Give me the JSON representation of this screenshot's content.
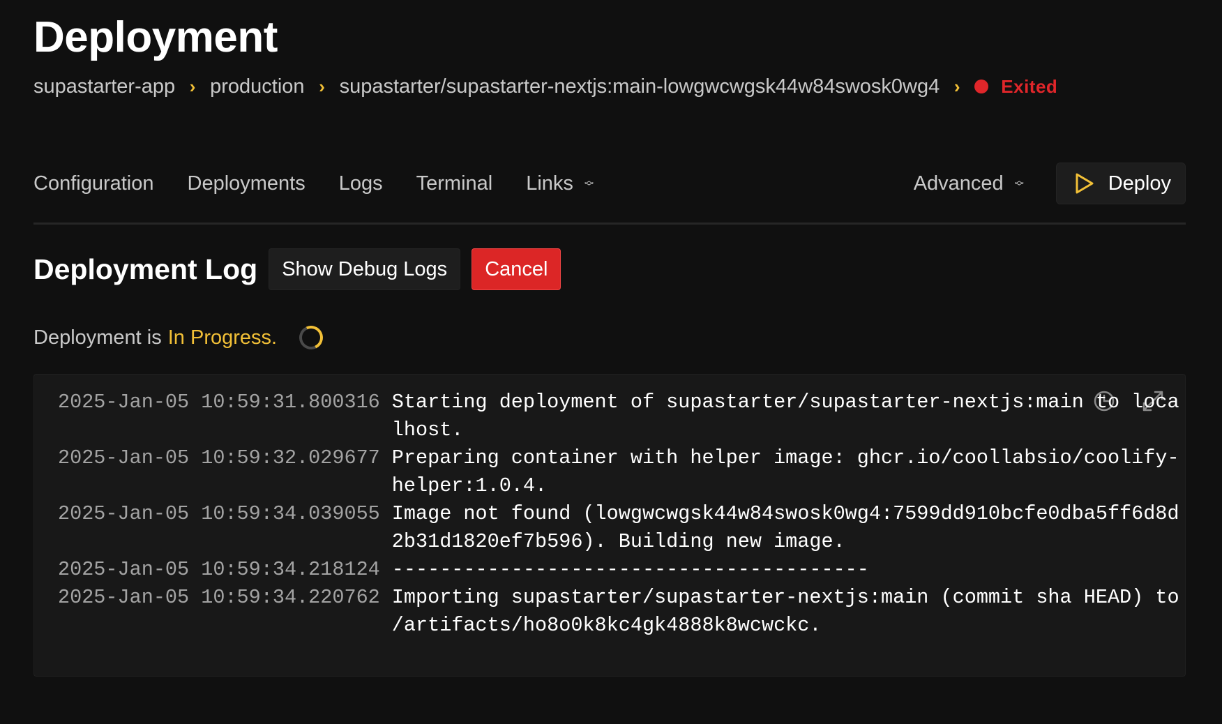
{
  "page": {
    "title": "Deployment"
  },
  "breadcrumb": {
    "items": [
      "supastarter-app",
      "production",
      "supastarter/supastarter-nextjs:main-lowgwcwgsk44w84swosk0wg4"
    ],
    "status": "Exited",
    "status_color": "#e0262a"
  },
  "nav": {
    "tabs": [
      "Configuration",
      "Deployments",
      "Logs",
      "Terminal",
      "Links"
    ],
    "advanced_label": "Advanced",
    "deploy_label": "Deploy"
  },
  "log_section": {
    "title": "Deployment Log",
    "debug_button": "Show Debug Logs",
    "cancel_button": "Cancel",
    "status_prefix": "Deployment is",
    "status_value": "In Progress.",
    "status_color": "#f2c037"
  },
  "log": {
    "lines": [
      {
        "time": "2025-Jan-05 10:59:31.800316",
        "text": "Starting deployment of supastarter/supastarter-nextjs:main to localhost."
      },
      {
        "time": "2025-Jan-05 10:59:32.029677",
        "text": "Preparing container with helper image: ghcr.io/coollabsio/coolify-helper:1.0.4."
      },
      {
        "time": "2025-Jan-05 10:59:34.039055",
        "text": "Image not found (lowgwcwgsk44w84swosk0wg4:7599dd910bcfe0dba5ff6d8d2b31d1820ef7b596). Building new image."
      },
      {
        "time": "2025-Jan-05 10:59:34.218124",
        "text": "----------------------------------------"
      },
      {
        "time": "2025-Jan-05 10:59:34.220762",
        "text": "Importing supastarter/supastarter-nextjs:main (commit sha HEAD) to /artifacts/ho8o0k8kc4gk4888k8wcwckc."
      }
    ]
  },
  "icons": {
    "chevron": "chevron-right-icon",
    "deploy": "play-icon",
    "history": "clock-history-icon",
    "fullscreen": "expand-icon"
  }
}
